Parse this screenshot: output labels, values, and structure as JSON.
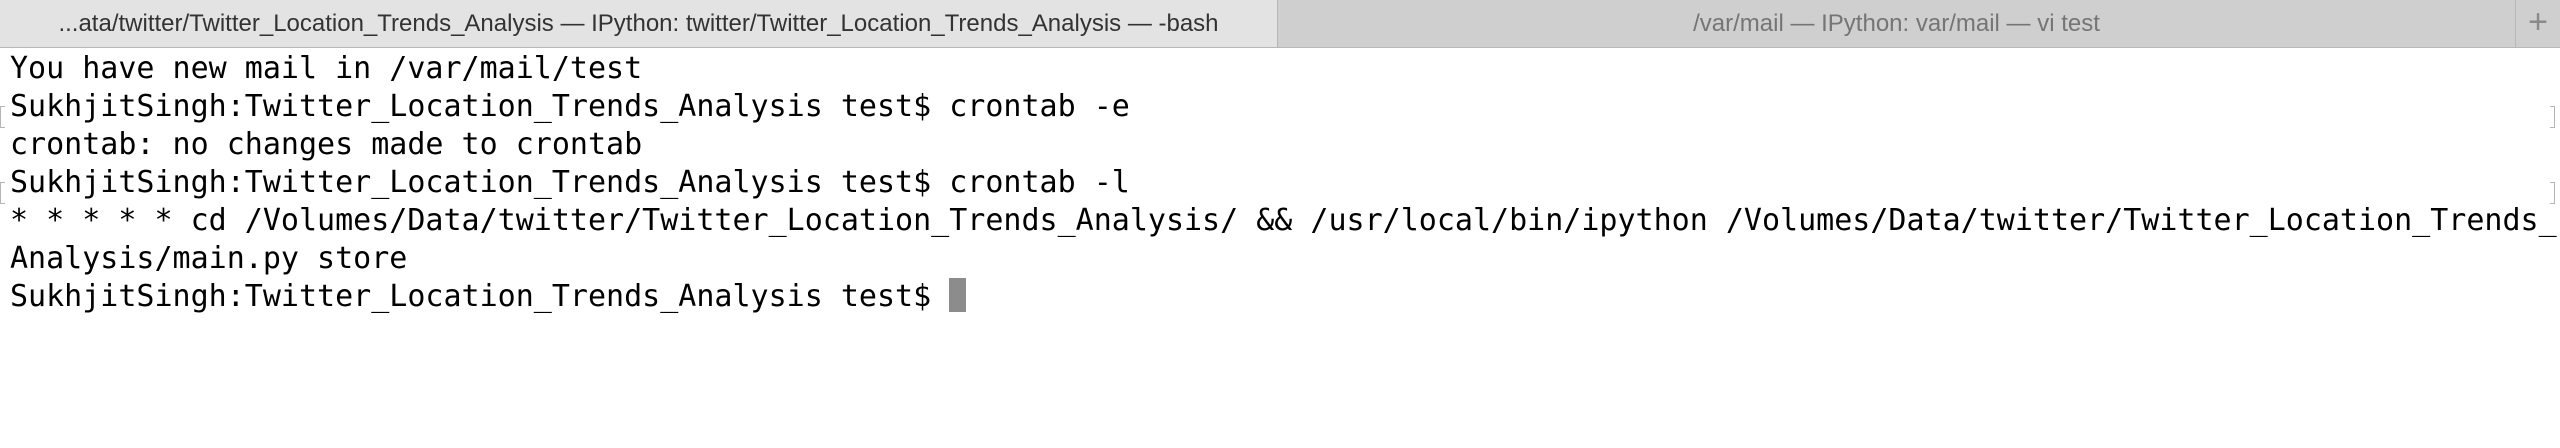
{
  "tabs": [
    {
      "label": "...ata/twitter/Twitter_Location_Trends_Analysis — IPython: twitter/Twitter_Location_Trends_Analysis — -bash",
      "active": true
    },
    {
      "label": "/var/mail — IPython: var/mail — vi test",
      "active": false
    }
  ],
  "new_tab_icon": "plus-icon",
  "new_tab_glyph": "+",
  "terminal": {
    "mail_notice": "You have new mail in /var/mail/test",
    "prompt": "SukhjitSingh:Twitter_Location_Trends_Analysis test$ ",
    "command_1": "crontab -e",
    "output_1": "crontab: no changes made to crontab",
    "command_2": "crontab -l",
    "cron_line_1": "* * * * * cd /Volumes/Data/twitter/Twitter_Location_Trends_Analysis/ && /usr/local/bin/ipython /Volumes/Data/twitter/Twitter_Location_Trends_",
    "cron_line_2": "Analysis/main.py store",
    "command_3": ""
  },
  "colors": {
    "tabbar_bg": "#d6d6d6",
    "active_tab_bg": "#e3e3e3",
    "inactive_tab_text": "#757575",
    "terminal_bg": "#ffffff",
    "terminal_text": "#000000",
    "cursor": "#8c8c8c"
  }
}
